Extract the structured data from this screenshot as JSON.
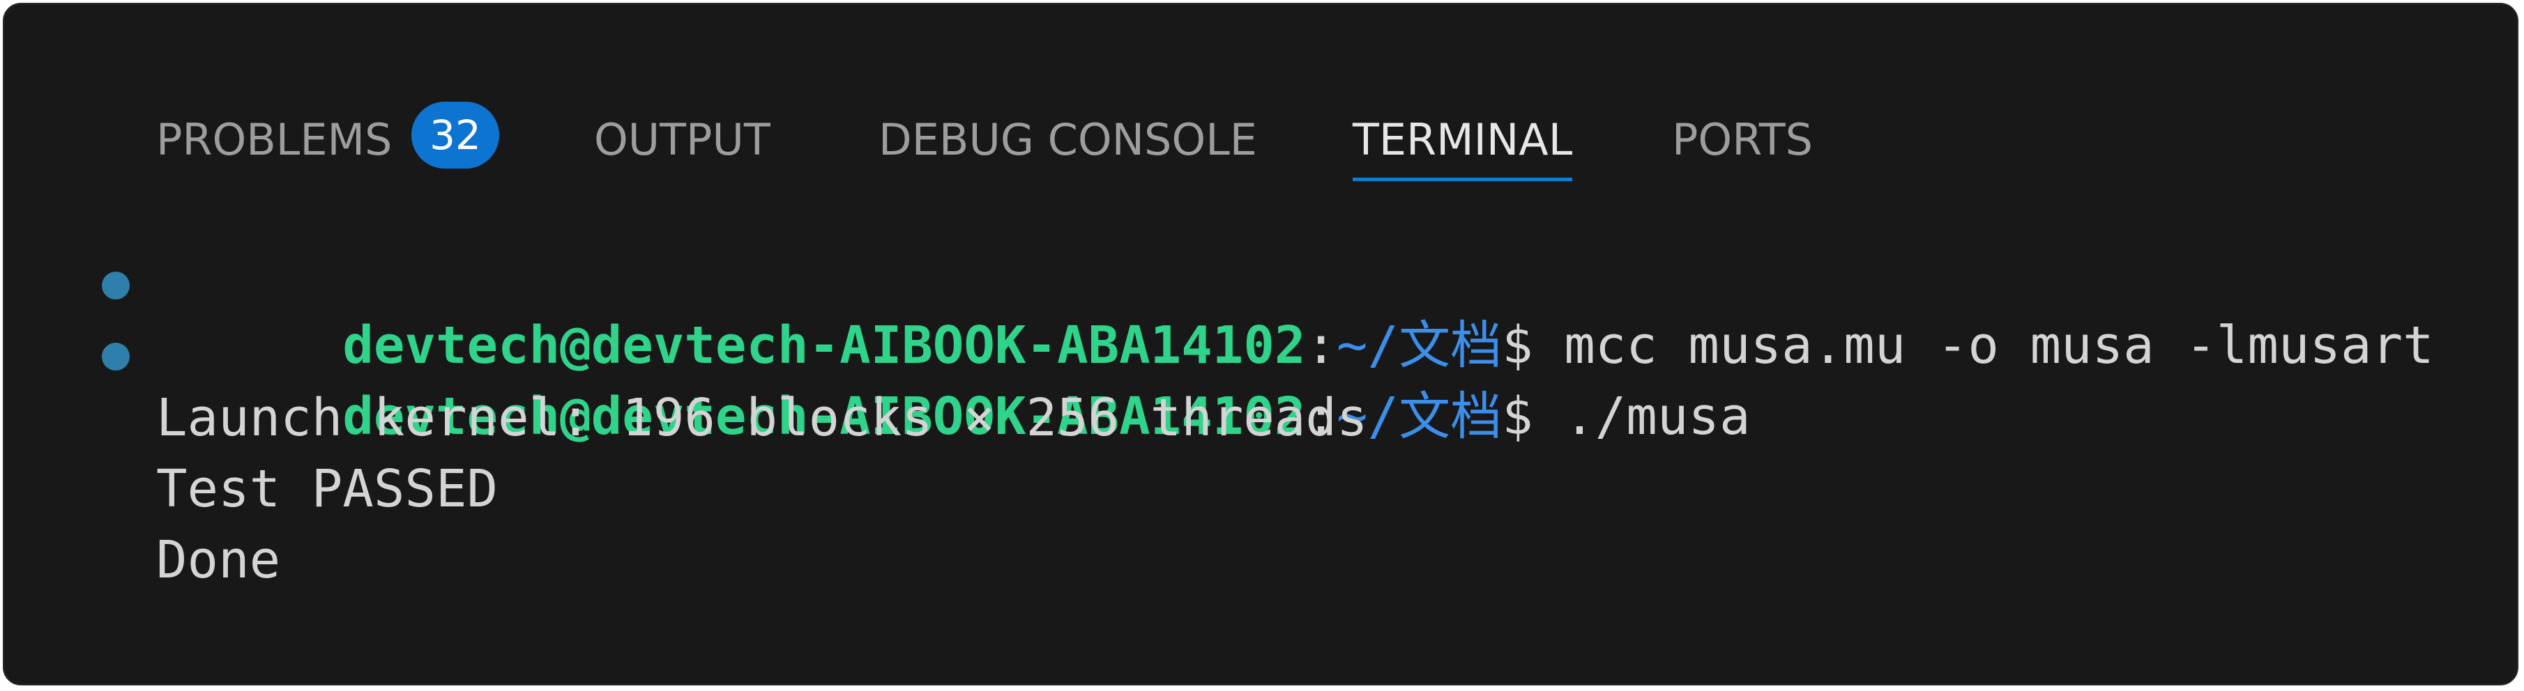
{
  "panel": {
    "tabs": [
      {
        "label": "PROBLEMS",
        "badge": "32"
      },
      {
        "label": "OUTPUT"
      },
      {
        "label": "DEBUG CONSOLE"
      },
      {
        "label": "TERMINAL",
        "active": true
      },
      {
        "label": "PORTS"
      }
    ]
  },
  "terminal": {
    "prompts": [
      {
        "user": "devtech@devtech-AIBOOK-ABA14102",
        "colon": ":",
        "path": "~/文档",
        "symbol": "$ ",
        "command": "mcc musa.mu -o musa -lmusart"
      },
      {
        "user": "devtech@devtech-AIBOOK-ABA14102",
        "colon": ":",
        "path": "~/文档",
        "symbol": "$ ",
        "command": "./musa"
      }
    ],
    "output": [
      "Launch kernel: 196 blocks × 256 threads",
      "Test PASSED",
      "Done"
    ]
  },
  "colors": {
    "background": "#181818",
    "prompt_user": "#2fd48a",
    "prompt_path": "#3b8eea",
    "accent": "#0e7fd4",
    "decoration_dot": "#2f7fad"
  }
}
